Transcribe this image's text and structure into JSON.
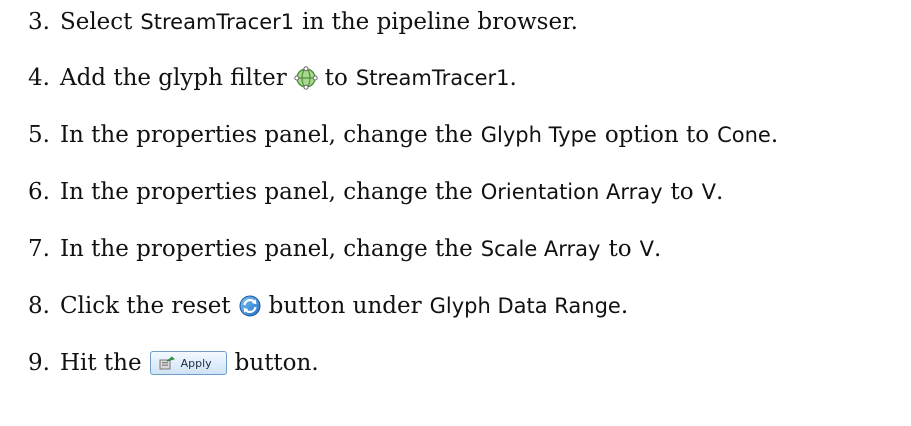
{
  "steps": [
    {
      "number": "3.",
      "text_1": "Select",
      "term_1": "StreamTracer1",
      "text_2": "in the pipeline browser."
    },
    {
      "number": "4.",
      "text_1": "Add the glyph filter",
      "icon": "glyph-filter-icon",
      "text_2": "to",
      "term_1": "StreamTracer1",
      "text_3": "."
    },
    {
      "number": "5.",
      "text_1": "In the properties panel, change the",
      "term_1": "Glyph Type",
      "text_2": "option to",
      "term_2": "Cone",
      "text_3": "."
    },
    {
      "number": "6.",
      "text_1": "In the properties panel, change the",
      "term_1": "Orientation Array",
      "text_2": "to",
      "term_2": "V",
      "text_3": "."
    },
    {
      "number": "7.",
      "text_1": "In the properties panel, change the",
      "term_1": "Scale Array",
      "text_2": "to",
      "term_2": "V",
      "text_3": "."
    },
    {
      "number": "8.",
      "text_1": "Click the reset",
      "icon": "reset-icon",
      "text_2": "button under",
      "term_1": "Glyph Data Range",
      "text_3": "."
    },
    {
      "number": "9.",
      "text_1": "Hit the",
      "button_label": "Apply",
      "icon": "apply-icon",
      "text_2": "button."
    }
  ]
}
